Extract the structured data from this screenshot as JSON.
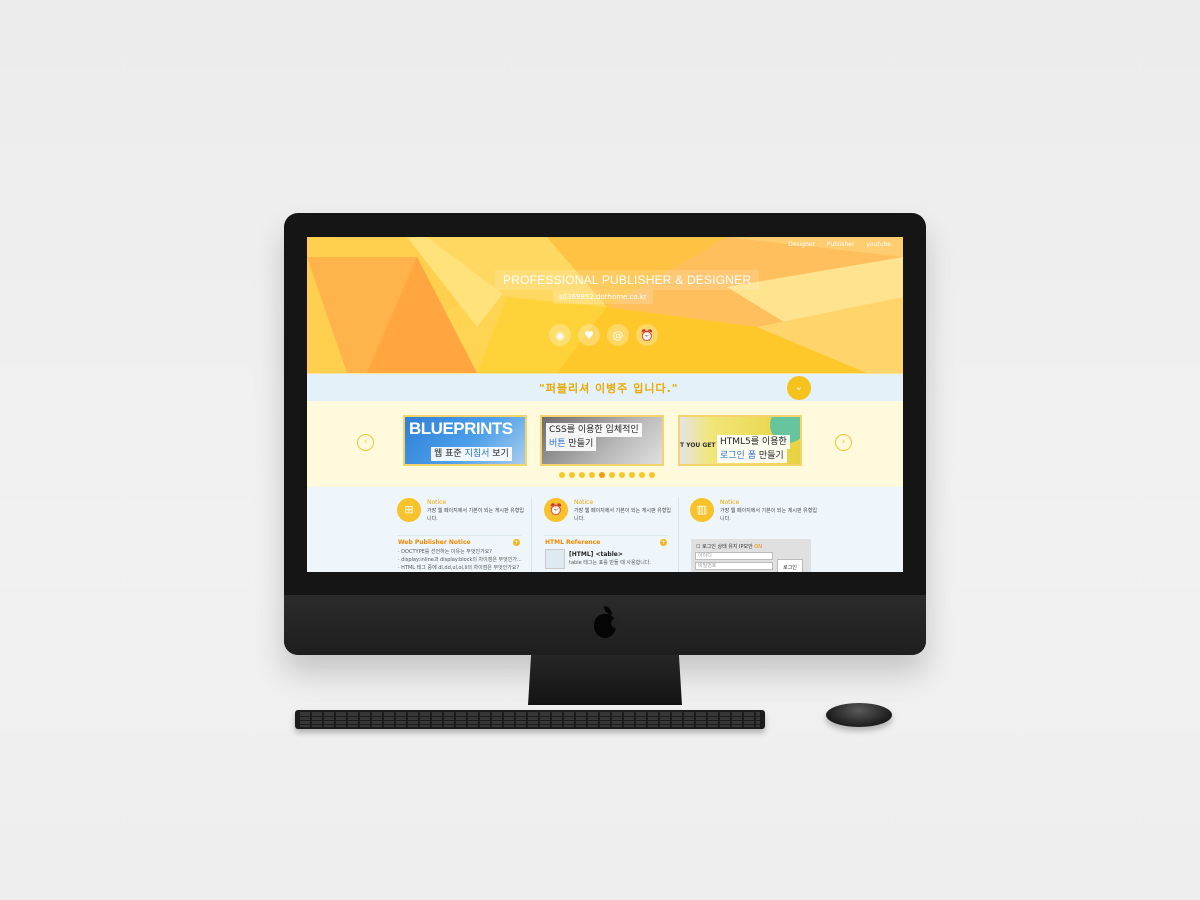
{
  "nav": {
    "items": [
      "Designer",
      "Publisher",
      "youtube"
    ]
  },
  "hero": {
    "title": "PROFESSIONAL PUBLISHER & DESIGNER",
    "subtitle": "s0369852.dothome.co.kr",
    "icons": [
      "target-icon",
      "heart-icon",
      "at-icon",
      "alarm-clock-icon"
    ]
  },
  "quote": {
    "text": "\"퍼블리셔 이병주 입니다.\""
  },
  "slides": [
    {
      "big": "BLUEPRINTS",
      "label_a": "웹 표준 ",
      "label_hl": "지침서",
      "label_b": " 보기"
    },
    {
      "line1": "CSS를 이용한 입체적인",
      "line2_hl": "버튼",
      "line2_b": " 만들기"
    },
    {
      "ghost": "T YOU GET",
      "line1": "HTML5를 이용한",
      "line2_hl": "로그인 폼",
      "line2_b": " 만들기"
    }
  ],
  "slider": {
    "dots": 10,
    "active_dot": 4
  },
  "columns": [
    {
      "notice_title": "Notice",
      "notice_desc": "가장 웹 페이지에서 기본이 되는 게시판 유형입니다.",
      "section_title": "Web Publisher Notice",
      "items": [
        "· DOCTYPE를 선언하는 이유는 무엇인가요?",
        "· display:inline과 display:block의 차이점은 무엇인가...",
        "· HTML 태그 중에 dl,dd,ul,ol,li의 차이점은 무엇인가요?"
      ]
    },
    {
      "notice_title": "Notice",
      "notice_desc": "가장 웹 페이지에서 기본이 되는 게시판 유형입니다.",
      "section_title": "HTML Reference",
      "ref_title": "[HTML] <table>",
      "ref_desc": "table 태그는 표를 만들 때 사용합니다."
    },
    {
      "notice_title": "Notice",
      "notice_desc": "가장 웹 페이지에서 기본이 되는 게시판 유형입니다.",
      "login_keep": "로그인 상태 유지",
      "login_ip": "IP보안",
      "login_ip_on": "ON",
      "id_placeholder": "아이디",
      "pw_placeholder": "비밀번호",
      "login_button": "로그인"
    }
  ],
  "colors": {
    "accent": "#f7c22a",
    "highlight": "#2f73c9",
    "orange": "#f08800"
  }
}
